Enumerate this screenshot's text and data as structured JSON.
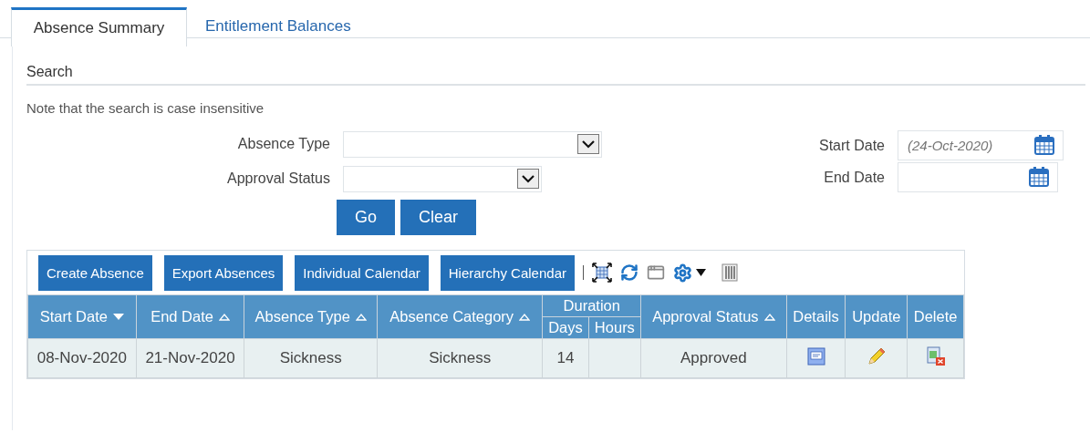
{
  "tabs": [
    {
      "label": "Absence Summary",
      "selected": true
    },
    {
      "label": "Entitlement Balances",
      "selected": false
    }
  ],
  "search": {
    "title": "Search",
    "note": "Note that the search is case insensitive",
    "fields": [
      {
        "label": "Absence Type",
        "kind": "select"
      },
      {
        "label": "Approval Status",
        "kind": "select"
      }
    ],
    "date_fields": [
      {
        "label": "Start Date",
        "placeholder": "(24-Oct-2020)"
      },
      {
        "label": "End Date"
      }
    ],
    "buttons": [
      "Go",
      "Clear"
    ]
  },
  "toolbar": {
    "buttons": [
      "Create Absence",
      "Export Absences",
      "Individual Calendar",
      "Hierarchy Calendar"
    ]
  },
  "table": {
    "columns": [
      {
        "label": "Start Date",
        "sorted": true
      },
      {
        "label": "End Date",
        "sorted": false
      },
      {
        "label": "Absence Type",
        "sorted": false
      },
      {
        "label": "Absence Category",
        "sorted": false
      }
    ],
    "group": {
      "label": "Duration",
      "columns": [
        "Days",
        "Hours"
      ]
    },
    "after_columns": [
      {
        "label": "Approval Status",
        "sorted": false
      }
    ],
    "action_columns": [
      "Details",
      "Update",
      "Delete"
    ],
    "rows": [
      {
        "start_date": "08-Nov-2020",
        "end_date": "21-Nov-2020",
        "absence_type": "Sickness",
        "absence_category": "Sickness",
        "days": "14",
        "approval_status": "Approved"
      }
    ]
  }
}
